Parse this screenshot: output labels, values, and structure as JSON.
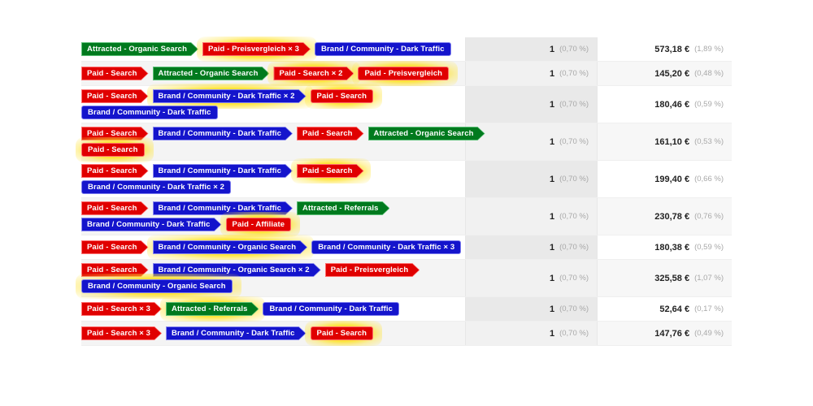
{
  "table": {
    "columns": [
      "path",
      "count",
      "value"
    ],
    "rows": [
      {
        "lines": [
          [
            {
              "label": "Attracted - Organic Search",
              "color": "green",
              "shape": "arrow",
              "glow": false
            },
            {
              "label": "Paid - Preisvergleich × 3",
              "color": "red",
              "shape": "arrow",
              "glow": true
            },
            {
              "label": "Brand / Community - Dark Traffic",
              "color": "blue",
              "shape": "flat",
              "glow": false
            }
          ]
        ],
        "count": "1",
        "count_pct": "(0,70 %)",
        "value": "573,18 €",
        "value_pct": "(1,89 %)"
      },
      {
        "lines": [
          [
            {
              "label": "Paid - Search",
              "color": "red",
              "shape": "arrow",
              "glow": false
            },
            {
              "label": "Attracted - Organic Search",
              "color": "green",
              "shape": "arrow",
              "glow": false
            },
            {
              "label": "Paid - Search × 2",
              "color": "red",
              "shape": "arrow",
              "glow": true
            },
            {
              "label": "Paid - Preisvergleich",
              "color": "red",
              "shape": "flat",
              "glow": true
            }
          ]
        ],
        "count": "1",
        "count_pct": "(0,70 %)",
        "value": "145,20 €",
        "value_pct": "(0,48 %)"
      },
      {
        "lines": [
          [
            {
              "label": "Paid - Search",
              "color": "red",
              "shape": "arrow",
              "glow": false
            },
            {
              "label": "Brand / Community - Dark Traffic × 2",
              "color": "blue",
              "shape": "arrow",
              "glow": true
            },
            {
              "label": "Paid - Search",
              "color": "red",
              "shape": "flat",
              "glow": true
            }
          ],
          [
            {
              "label": "Brand / Community - Dark Traffic",
              "color": "blue",
              "shape": "flat",
              "glow": false
            }
          ]
        ],
        "count": "1",
        "count_pct": "(0,70 %)",
        "value": "180,46 €",
        "value_pct": "(0,59 %)"
      },
      {
        "lines": [
          [
            {
              "label": "Paid - Search",
              "color": "red",
              "shape": "arrow",
              "glow": false
            },
            {
              "label": "Brand / Community - Dark Traffic",
              "color": "blue",
              "shape": "arrow",
              "glow": false
            },
            {
              "label": "Paid - Search",
              "color": "red",
              "shape": "arrow",
              "glow": false
            },
            {
              "label": "Attracted - Organic Search",
              "color": "green",
              "shape": "arrow",
              "glow": false
            }
          ],
          [
            {
              "label": "Paid - Search",
              "color": "red",
              "shape": "flat",
              "glow": true
            }
          ]
        ],
        "count": "1",
        "count_pct": "(0,70 %)",
        "value": "161,10 €",
        "value_pct": "(0,53 %)"
      },
      {
        "lines": [
          [
            {
              "label": "Paid - Search",
              "color": "red",
              "shape": "arrow",
              "glow": false
            },
            {
              "label": "Brand / Community - Dark Traffic",
              "color": "blue",
              "shape": "arrow",
              "glow": false
            },
            {
              "label": "Paid - Search",
              "color": "red",
              "shape": "arrow",
              "glow": true
            }
          ],
          [
            {
              "label": "Brand / Community - Dark Traffic × 2",
              "color": "blue",
              "shape": "flat",
              "glow": false
            }
          ]
        ],
        "count": "1",
        "count_pct": "(0,70 %)",
        "value": "199,40 €",
        "value_pct": "(0,66 %)"
      },
      {
        "lines": [
          [
            {
              "label": "Paid - Search",
              "color": "red",
              "shape": "arrow",
              "glow": false
            },
            {
              "label": "Brand / Community - Dark Traffic",
              "color": "blue",
              "shape": "arrow",
              "glow": false
            },
            {
              "label": "Attracted - Referrals",
              "color": "green",
              "shape": "arrow",
              "glow": false
            }
          ],
          [
            {
              "label": "Brand / Community - Dark Traffic",
              "color": "blue",
              "shape": "arrow",
              "glow": false
            },
            {
              "label": "Paid - Affiliate",
              "color": "red",
              "shape": "flat",
              "glow": true
            }
          ]
        ],
        "count": "1",
        "count_pct": "(0,70 %)",
        "value": "230,78 €",
        "value_pct": "(0,76 %)"
      },
      {
        "lines": [
          [
            {
              "label": "Paid - Search",
              "color": "red",
              "shape": "arrow",
              "glow": false
            },
            {
              "label": "Brand / Community - Organic Search",
              "color": "blue",
              "shape": "arrow",
              "glow": true
            },
            {
              "label": "Brand / Community - Dark Traffic × 3",
              "color": "blue",
              "shape": "flat",
              "glow": false
            }
          ]
        ],
        "count": "1",
        "count_pct": "(0,70 %)",
        "value": "180,38 €",
        "value_pct": "(0,59 %)"
      },
      {
        "lines": [
          [
            {
              "label": "Paid - Search",
              "color": "red",
              "shape": "arrow",
              "glow": false
            },
            {
              "label": "Brand / Community - Organic Search × 2",
              "color": "blue",
              "shape": "arrow",
              "glow": false
            },
            {
              "label": "Paid - Preisvergleich",
              "color": "red",
              "shape": "arrow",
              "glow": false
            }
          ],
          [
            {
              "label": "Brand / Community - Organic Search",
              "color": "blue",
              "shape": "flat",
              "glow": true
            }
          ]
        ],
        "count": "1",
        "count_pct": "(0,70 %)",
        "value": "325,58 €",
        "value_pct": "(1,07 %)"
      },
      {
        "lines": [
          [
            {
              "label": "Paid - Search × 3",
              "color": "red",
              "shape": "arrow",
              "glow": false
            },
            {
              "label": "Attracted - Referrals",
              "color": "green",
              "shape": "arrow",
              "glow": true
            },
            {
              "label": "Brand / Community - Dark Traffic",
              "color": "blue",
              "shape": "flat",
              "glow": false
            }
          ]
        ],
        "count": "1",
        "count_pct": "(0,70 %)",
        "value": "52,64 €",
        "value_pct": "(0,17 %)"
      },
      {
        "lines": [
          [
            {
              "label": "Paid - Search × 3",
              "color": "red",
              "shape": "arrow",
              "glow": false
            },
            {
              "label": "Brand / Community - Dark Traffic",
              "color": "blue",
              "shape": "arrow",
              "glow": false
            },
            {
              "label": "Paid - Search",
              "color": "red",
              "shape": "flat",
              "glow": true
            }
          ]
        ],
        "count": "1",
        "count_pct": "(0,70 %)",
        "value": "147,76 €",
        "value_pct": "(0,49 %)"
      }
    ]
  },
  "colors": {
    "paid": "#e00000",
    "brand_community": "#1414cc",
    "attracted": "#007a1e",
    "highlight_glow": "#ffdd00",
    "row_shade": "#f4f4f4",
    "count_col_shade": "#f1f1f1"
  }
}
